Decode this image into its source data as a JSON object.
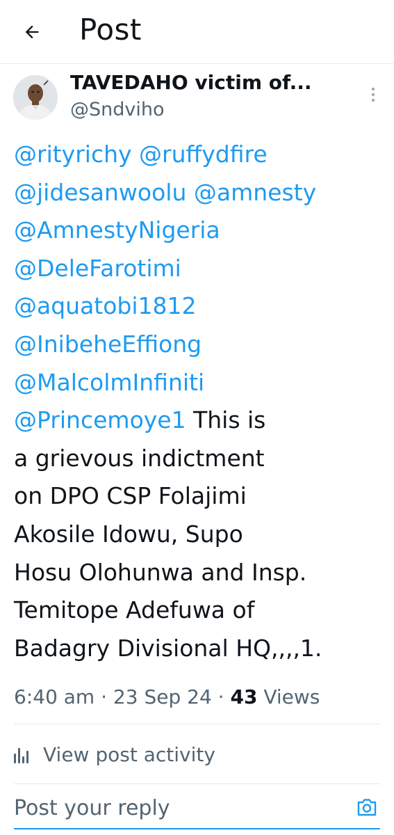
{
  "header": {
    "title": "Post",
    "back_icon": "arrow-left-icon"
  },
  "author": {
    "display_name": "TAVEDAHO victim of...",
    "handle": "@Sndviho",
    "more_icon": "more-vertical-icon"
  },
  "post": {
    "lines": [
      [
        {
          "text": "@rityrichy",
          "mention": true
        },
        {
          "text": " ",
          "mention": false
        },
        {
          "text": "@ruffydfire",
          "mention": true
        }
      ],
      [
        {
          "text": "@jidesanwoolu",
          "mention": true
        },
        {
          "text": " ",
          "mention": false
        },
        {
          "text": "@amnesty",
          "mention": true
        }
      ],
      [
        {
          "text": "@AmnestyNigeria",
          "mention": true
        }
      ],
      [
        {
          "text": "@DeleFarotimi",
          "mention": true
        }
      ],
      [
        {
          "text": "@aquatobi1812",
          "mention": true
        }
      ],
      [
        {
          "text": "@InibeheEffiong",
          "mention": true
        }
      ],
      [
        {
          "text": "@MalcolmInfiniti",
          "mention": true
        }
      ],
      [
        {
          "text": "@Princemoye1",
          "mention": true
        },
        {
          "text": " This is",
          "mention": false
        }
      ],
      [
        {
          "text": "a grievous indictment",
          "mention": false
        }
      ],
      [
        {
          "text": "on DPO CSP Folajimi",
          "mention": false
        }
      ],
      [
        {
          "text": "Akosile Idowu, Supo",
          "mention": false
        }
      ],
      [
        {
          "text": "Hosu Olohunwa and Insp.",
          "mention": false
        }
      ],
      [
        {
          "text": "Temitope Adefuwa of",
          "mention": false
        }
      ],
      [
        {
          "text": "Badagry Divisional HQ,,,,1.",
          "mention": false
        }
      ]
    ]
  },
  "meta": {
    "time": "6:40 am",
    "separator": " · ",
    "date": "23 Sep 24",
    "views_count": "43",
    "views_label": " Views"
  },
  "activity": {
    "label": "View post activity",
    "icon": "bar-chart-icon"
  },
  "reply": {
    "placeholder": "Post your reply",
    "camera_icon": "camera-icon"
  },
  "colors": {
    "mention": "#1d9bf0",
    "text": "#0f1419",
    "secondary": "#536471",
    "accent": "#1d9bf0"
  }
}
